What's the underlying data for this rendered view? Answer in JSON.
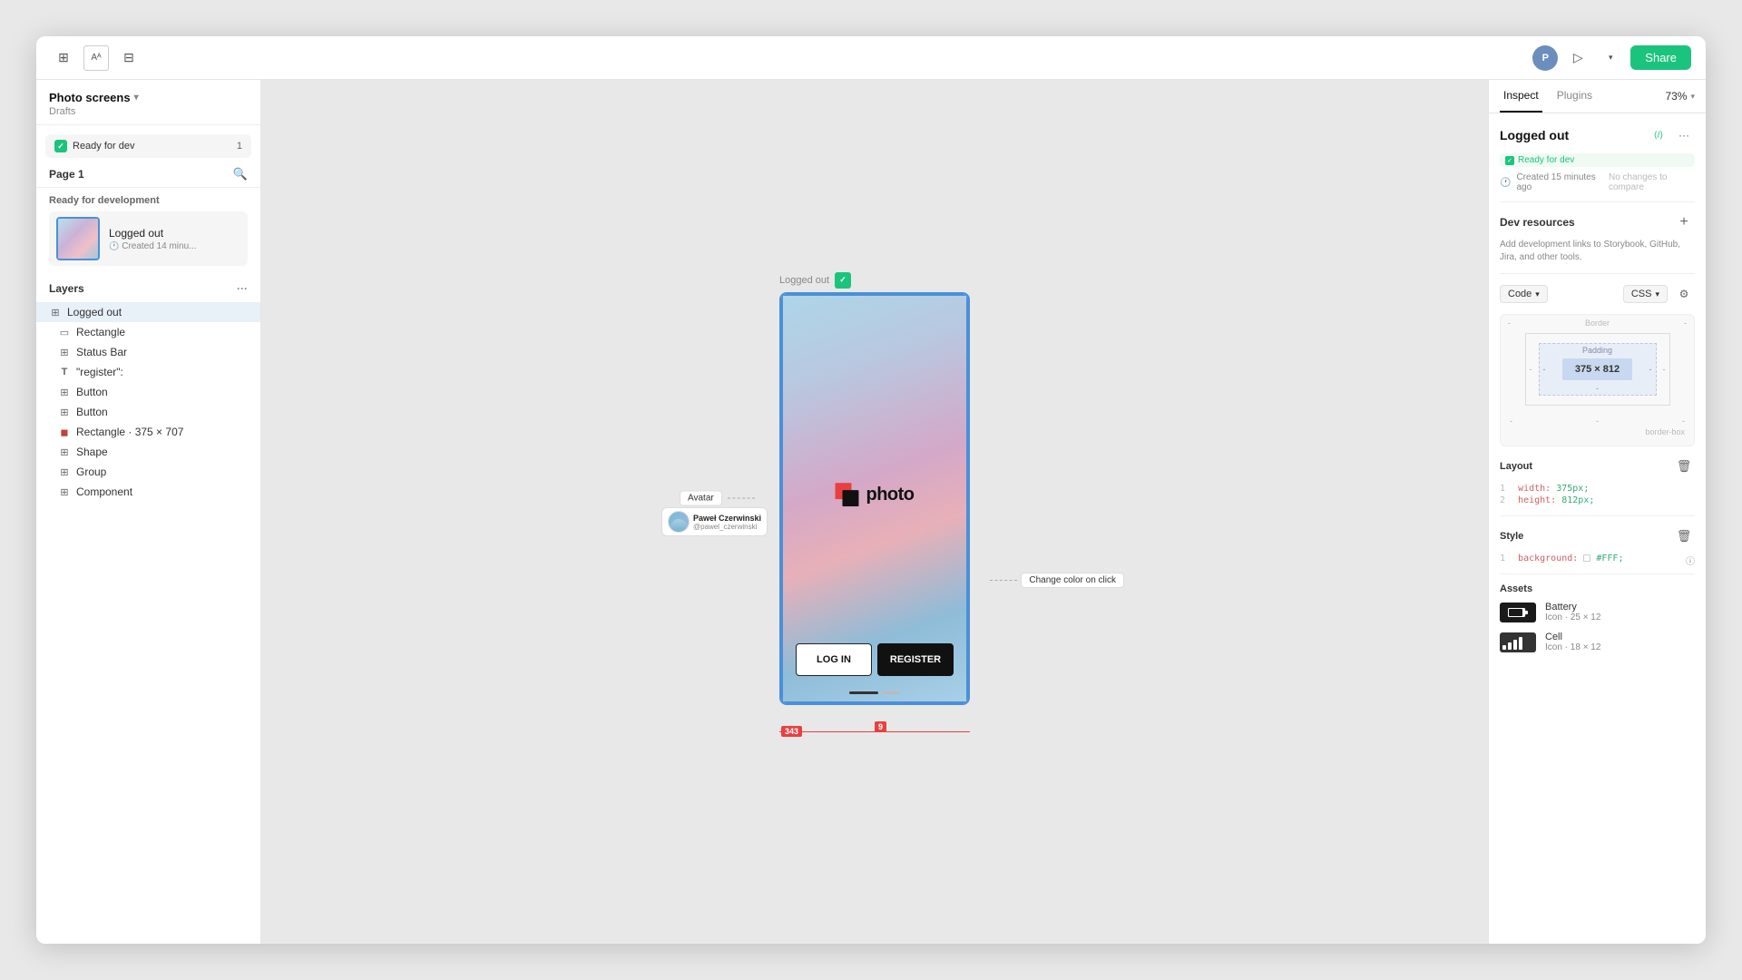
{
  "window": {
    "title": "Photo screens"
  },
  "topbar": {
    "project_name": "Photo screens",
    "drafts": "Drafts",
    "share_label": "Share",
    "zoom": "73%",
    "inspect_tab": "Inspect",
    "plugins_tab": "Plugins"
  },
  "left_sidebar": {
    "project_name": "Photo screens",
    "drafts": "Drafts",
    "ready_label": "Ready for dev",
    "ready_count": "1",
    "page_label": "Page 1",
    "ready_for_dev_section": "Ready for development",
    "frame_name": "Logged out",
    "frame_time": "Created 14 minu...",
    "layers_title": "Layers",
    "layers": [
      {
        "name": "Logged out",
        "icon": "⊞",
        "indent": 0,
        "active": true
      },
      {
        "name": "Rectangle",
        "icon": "▭",
        "indent": 1
      },
      {
        "name": "Status Bar",
        "icon": "⊞",
        "indent": 1
      },
      {
        "name": "\"register\":",
        "icon": "T",
        "indent": 1
      },
      {
        "name": "Button",
        "icon": "⊞",
        "indent": 1
      },
      {
        "name": "Button",
        "icon": "⊞",
        "indent": 1
      },
      {
        "name": "Rectangle · 375 × 707",
        "icon": "◼",
        "indent": 1
      },
      {
        "name": "Shape",
        "icon": "⊞",
        "indent": 1
      },
      {
        "name": "Group",
        "icon": "⊞",
        "indent": 1
      },
      {
        "name": "Component",
        "icon": "⊞",
        "indent": 1
      }
    ]
  },
  "canvas": {
    "frame_label": "Logged out",
    "login_btn": "LOG IN",
    "register_btn": "REGISTER",
    "logo_text": "photo",
    "measurement_bottom": "9",
    "measurement_width": "343",
    "annotation_avatar": "Avatar",
    "annotation_change": "Change color on click",
    "annotation_user": "Paweł Czerwinski",
    "annotation_user_sub": "@pawel_czerwinski"
  },
  "right_sidebar": {
    "inspect_tab": "Inspect",
    "plugins_tab": "Plugins",
    "frame_name": "Logged out",
    "ready_label": "Ready for dev",
    "created": "Created 15 minutes ago",
    "no_changes": "No changes to compare",
    "dev_resources_title": "Dev resources",
    "dev_resources_desc": "Add development links to Storybook, GitHub, Jira, and other tools.",
    "code_label": "Code",
    "css_label": "CSS",
    "layout_title": "Layout",
    "layout_code": [
      {
        "num": "1",
        "prop": "width:",
        "val": "375px;"
      },
      {
        "num": "2",
        "prop": "height:",
        "val": "812px;"
      }
    ],
    "style_title": "Style",
    "style_code": [
      {
        "num": "1",
        "prop": "background:",
        "val": "#FFF;"
      }
    ],
    "box_size": "375 × 812",
    "box_padding_label": "Padding",
    "box_border_label": "Border",
    "border_box": "border-box",
    "assets_title": "Assets",
    "assets": [
      {
        "name": "Battery",
        "meta": "Icon · 25 × 12"
      },
      {
        "name": "Cell",
        "meta": "Icon · 18 × 12"
      }
    ]
  }
}
